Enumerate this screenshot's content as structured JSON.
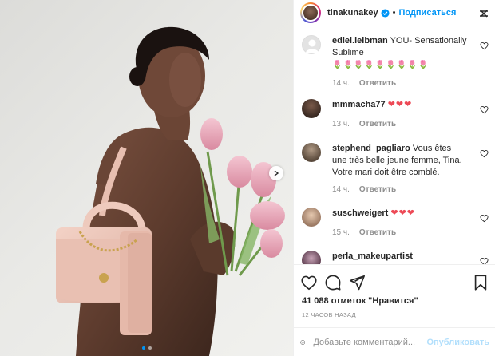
{
  "post": {
    "carousel": {
      "slide_count": 2,
      "active_slide": 1
    }
  },
  "header": {
    "username": "tinakunakey",
    "separator": "•",
    "follow_label": "Подписаться",
    "verified": true
  },
  "comments": [
    {
      "username": "ediei.leibman",
      "text": "YOU- Sensationally Sublime",
      "extra": "🌷🌷🌷🌷🌷🌷🌷🌷🌷",
      "time": "14 ч.",
      "reply": "Ответить"
    },
    {
      "username": "mmmacha77",
      "text": "",
      "extra": "❤❤❤",
      "time": "13 ч.",
      "reply": "Ответить"
    },
    {
      "username": "stephend_pagliaro",
      "text": "Vous êtes une très belle jeune femme, Tina. Votre mari doit être comblé.",
      "extra": "",
      "time": "14 ч.",
      "reply": "Ответить"
    },
    {
      "username": "suschweigert",
      "text": "",
      "extra": "❤❤❤",
      "time": "15 ч.",
      "reply": "Ответить"
    },
    {
      "username": "perla_makeupartist",
      "text": "",
      "extra": "",
      "time": "",
      "reply": ""
    }
  ],
  "actions": {
    "like_icon": "heart-icon",
    "comment_icon": "comment-icon",
    "share_icon": "share-icon",
    "save_icon": "bookmark-icon"
  },
  "likes_text": "41 088 отметок \"Нравится\"",
  "timestamp": "12 ЧАСОВ НАЗАД",
  "add_comment": {
    "placeholder": "Добавьте комментарий...",
    "publish_label": "Опубликовать"
  },
  "colors": {
    "accent": "#0095f6",
    "like_red": "#ed4956",
    "muted": "#8e8e8e",
    "publish_disabled": "#b2dffc"
  }
}
